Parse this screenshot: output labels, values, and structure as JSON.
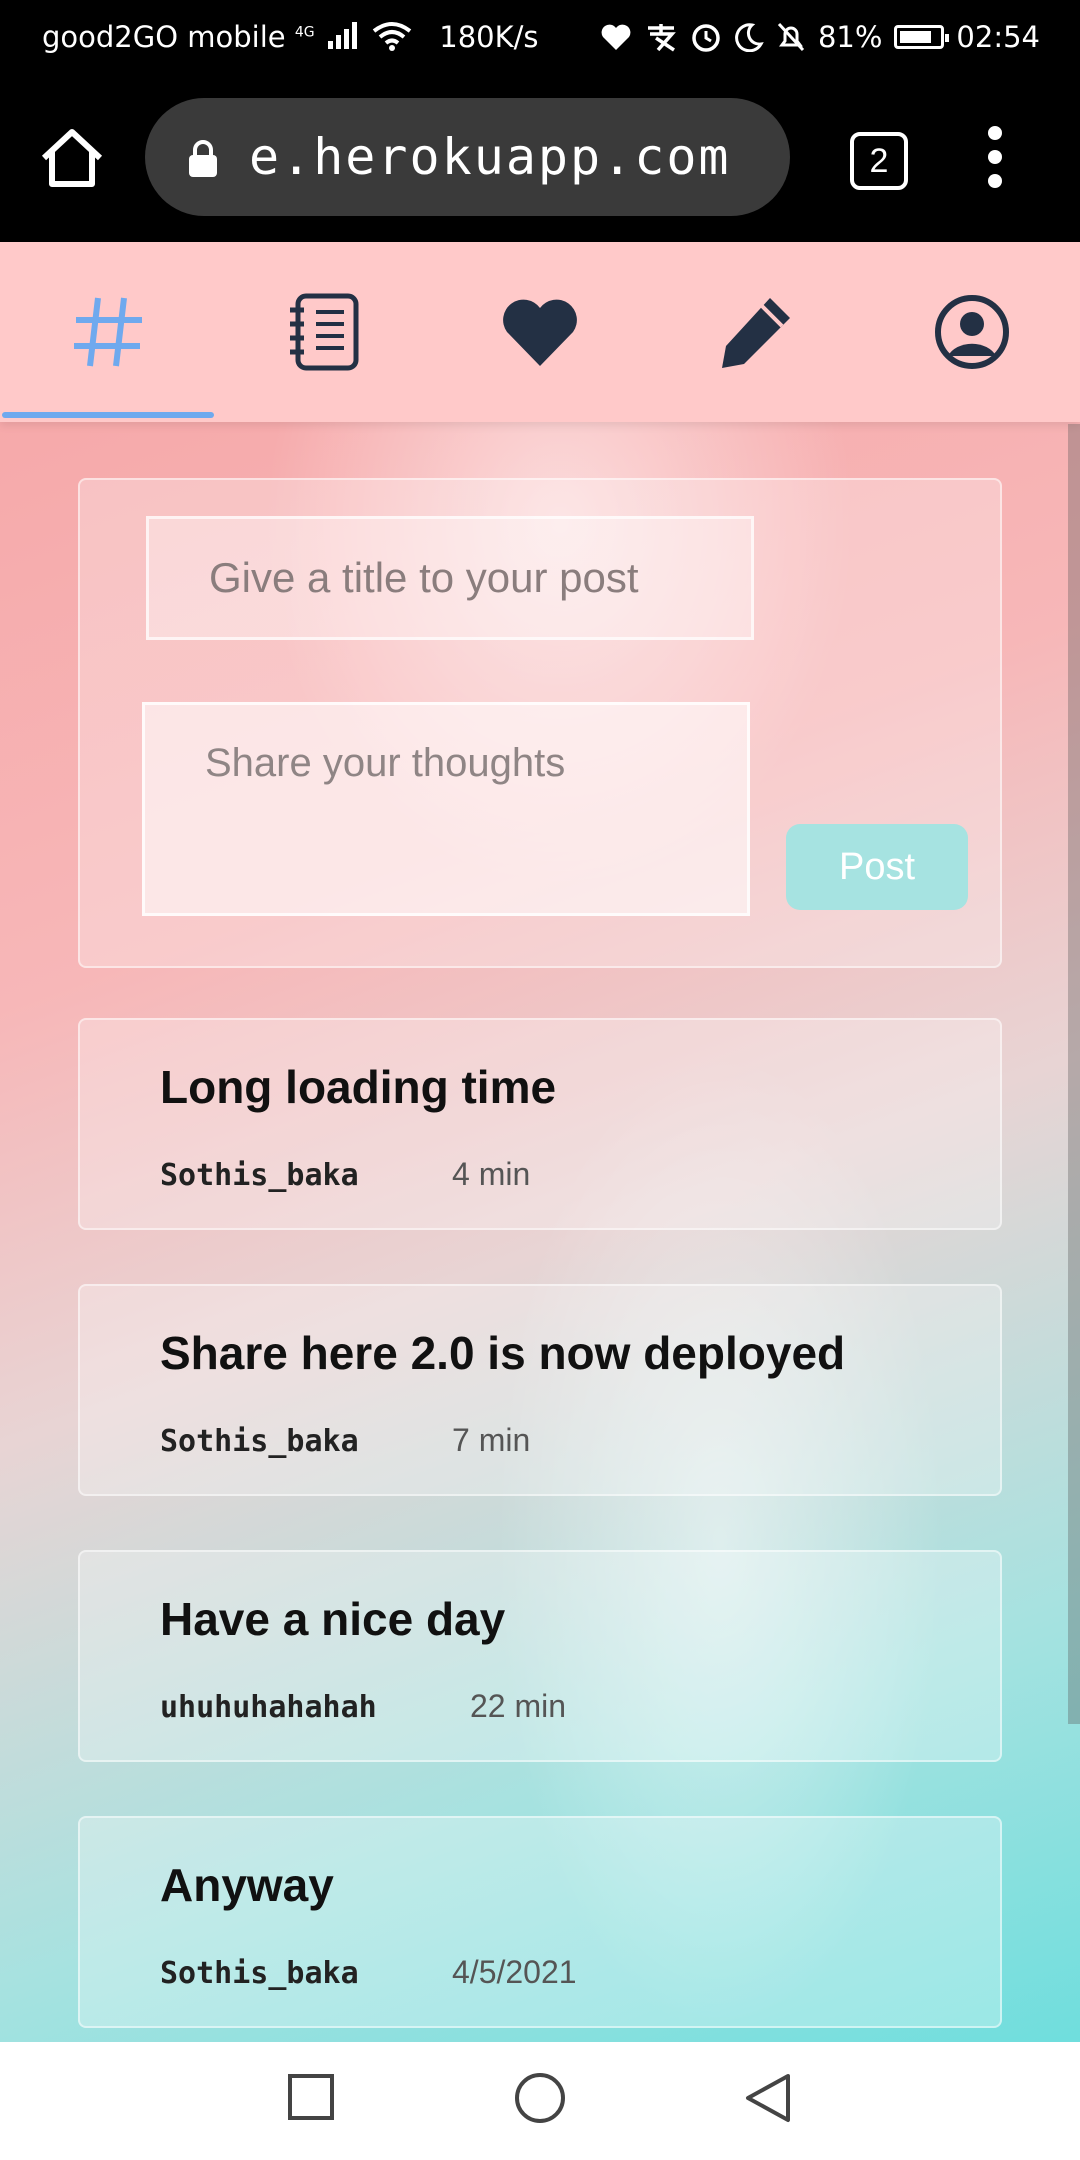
{
  "status_bar": {
    "carrier": "good2GO mobile",
    "network": "4G",
    "speed": "180K/s",
    "battery": "81%",
    "battery_level": 0.81,
    "time": "02:54"
  },
  "browser": {
    "url": "e.herokuapp.com",
    "tab_count": "2",
    "home_icon": "home-icon",
    "lock_icon": "lock-icon",
    "menu_icon": "more-vert-icon"
  },
  "nav": {
    "items": [
      {
        "icon": "hashtag-icon",
        "active": true
      },
      {
        "icon": "notebook-icon",
        "active": false
      },
      {
        "icon": "heart-icon",
        "active": false
      },
      {
        "icon": "pencil-icon",
        "active": false
      },
      {
        "icon": "user-circle-icon",
        "active": false
      }
    ],
    "active_color": "#6fa9ee",
    "icon_color": "#233044"
  },
  "composer": {
    "title_placeholder": "Give a title to your post",
    "body_placeholder": "Share your thoughts",
    "post_label": "Post"
  },
  "posts": [
    {
      "title": "Long loading time",
      "author": "Sothis_baka",
      "time": "4 min"
    },
    {
      "title": "Share here 2.0 is now deployed",
      "author": "Sothis_baka",
      "time": "7 min"
    },
    {
      "title": "Have a nice day",
      "author": "uhuhuhahahah",
      "time": "22 min"
    },
    {
      "title": "Anyway",
      "author": "Sothis_baka",
      "time": "4/5/2021"
    }
  ]
}
